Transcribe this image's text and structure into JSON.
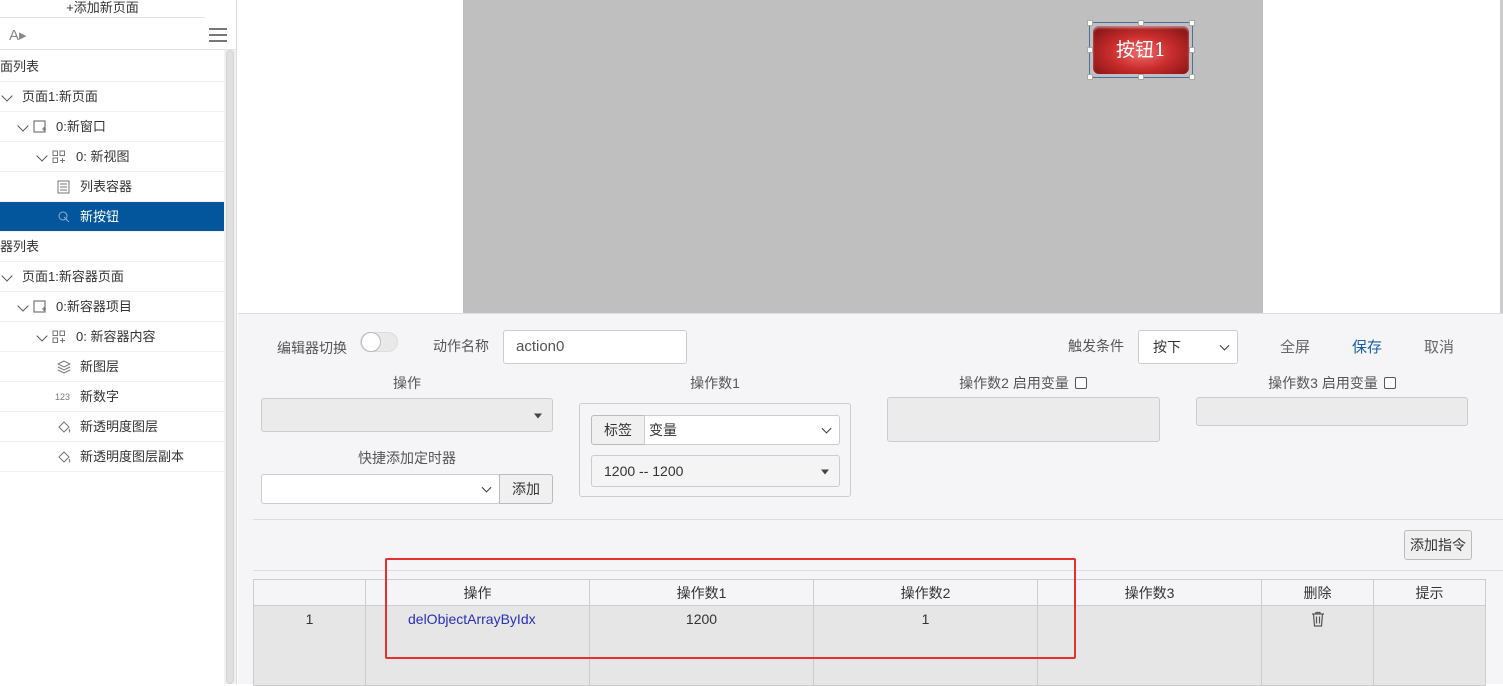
{
  "sidebar": {
    "add_page": "+添加新页面",
    "font_icon": "A▸",
    "tree": [
      {
        "label": "面列表",
        "type": "section",
        "indent": 0
      },
      {
        "label": "页面1:新页面",
        "type": "page",
        "indent": 1
      },
      {
        "label": "0:新窗口",
        "type": "window",
        "indent": 2
      },
      {
        "label": "0: 新视图",
        "type": "view",
        "indent": 3
      },
      {
        "label": "列表容器",
        "type": "list",
        "indent": 4
      },
      {
        "label": "新按钮",
        "type": "button",
        "indent": 4,
        "selected": true
      },
      {
        "label": "器列表",
        "type": "section",
        "indent": 0
      },
      {
        "label": "页面1:新容器页面",
        "type": "page",
        "indent": 1
      },
      {
        "label": "0:新容器项目",
        "type": "window",
        "indent": 2
      },
      {
        "label": "0: 新容器内容",
        "type": "view",
        "indent": 3
      },
      {
        "label": "新图层",
        "type": "layer",
        "indent": 4
      },
      {
        "label": "新数字",
        "type": "number",
        "indent": 4
      },
      {
        "label": "新透明度图层",
        "type": "alpha",
        "indent": 4
      },
      {
        "label": "新透明度图层副本",
        "type": "alpha",
        "indent": 4
      }
    ]
  },
  "canvas": {
    "button_text": "按钮1",
    "button_colors": {
      "center": "#f26b6b",
      "edge": "#7a1010"
    }
  },
  "editor": {
    "editor_switch_label": "编辑器切换",
    "action_name_label": "动作名称",
    "action_name_value": "action0",
    "trigger_label": "触发条件",
    "trigger_value": "按下",
    "fullscreen": "全屏",
    "save": "保存",
    "cancel": "取消",
    "op_label": "操作",
    "op_value": "",
    "operand1_label": "操作数1",
    "tag_button": "标签",
    "var_select": "变量",
    "operand1_value": "1200 -- 1200",
    "operand2_label": "操作数2 启用变量",
    "operand3_label": "操作数3 启用变量",
    "quick_timer_label": "快捷添加定时器",
    "quick_timer_value": "",
    "add_button": "添加",
    "add_command": "添加指令"
  },
  "table": {
    "headers": [
      "",
      "操作",
      "操作数1",
      "操作数2",
      "操作数3",
      "删除",
      "提示"
    ],
    "rows": [
      {
        "index": "1",
        "op": "delObjectArrayByIdx",
        "operand1": "1200",
        "operand2": "1",
        "operand3": "",
        "hint": ""
      }
    ]
  },
  "colors": {
    "selected_row": "#03569b",
    "highlight_border": "#e53030",
    "save_link": "#1a5ea8"
  }
}
